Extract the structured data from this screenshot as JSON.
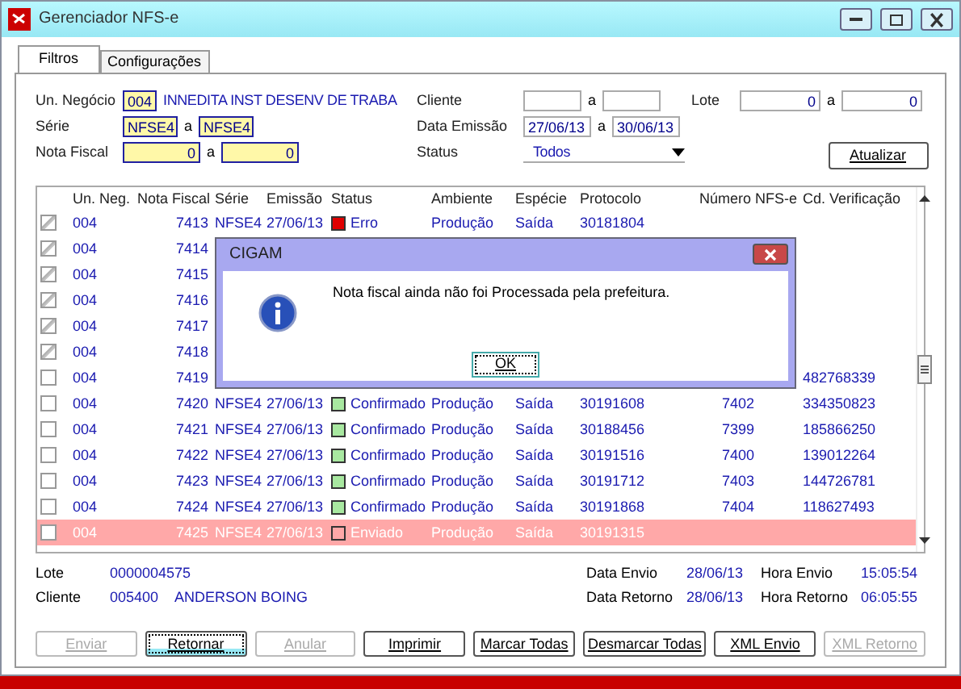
{
  "window": {
    "title": "Gerenciador NFS-e"
  },
  "tabs": [
    {
      "label": "Filtros",
      "selected": true
    },
    {
      "label": "Configurações",
      "selected": false
    }
  ],
  "filters": {
    "un_negocio": {
      "label": "Un. Negócio",
      "value": "004",
      "description": "INNEDITA INST DESENV DE TRABA",
      "required": true
    },
    "serie": {
      "label": "Série",
      "from": "NFSE4",
      "separator": "a",
      "to": "NFSE4",
      "required": true
    },
    "nota_fiscal": {
      "label": "Nota Fiscal",
      "from": "0",
      "separator": "a",
      "to": "0",
      "required": true
    },
    "cliente": {
      "label": "Cliente",
      "separator": "a",
      "required": false
    },
    "data_emissao": {
      "label": "Data Emissão",
      "from": "27/06/13",
      "separator": "a",
      "to": "30/06/13",
      "required": false
    },
    "status": {
      "label": "Status",
      "value": "Todos"
    },
    "lote": {
      "label": "Lote",
      "from": "0",
      "separator": "a",
      "to": "0",
      "required": false
    },
    "refresh_button": "Atualizar"
  },
  "table": {
    "columns": [
      "Un. Neg.",
      "Nota Fiscal",
      "Série",
      "Emissão",
      "Status",
      "Ambiente",
      "Espécie",
      "Protocolo",
      "Número NFS-e",
      "Cd. Verificação"
    ],
    "rows": [
      {
        "checked": true,
        "selected": false,
        "un_neg": "004",
        "nota_fiscal": "7413",
        "serie": "NFSE4",
        "emissao": "27/06/13",
        "status": "Erro",
        "color": "#e00000",
        "ambiente": "Produção",
        "especie": "Saída",
        "protocolo": "30181804"
      },
      {
        "checked": true,
        "selected": false,
        "un_neg": "004",
        "nota_fiscal": "7414"
      },
      {
        "checked": true,
        "selected": false,
        "un_neg": "004",
        "nota_fiscal": "7415"
      },
      {
        "checked": true,
        "selected": false,
        "un_neg": "004",
        "nota_fiscal": "7416"
      },
      {
        "checked": true,
        "selected": false,
        "un_neg": "004",
        "nota_fiscal": "7417"
      },
      {
        "checked": true,
        "selected": false,
        "un_neg": "004",
        "nota_fiscal": "7418"
      },
      {
        "checked": false,
        "selected": false,
        "un_neg": "004",
        "nota_fiscal": "7419",
        "cd_verificacao": "482768339"
      },
      {
        "checked": false,
        "selected": false,
        "un_neg": "004",
        "nota_fiscal": "7420",
        "serie": "NFSE4",
        "emissao": "27/06/13",
        "status": "Confirmado",
        "color": "#a8e8a0",
        "ambiente": "Produção",
        "especie": "Saída",
        "protocolo": "30191608",
        "numero_nfse": "7402",
        "cd_verificacao": "334350823"
      },
      {
        "checked": false,
        "selected": false,
        "un_neg": "004",
        "nota_fiscal": "7421",
        "serie": "NFSE4",
        "emissao": "27/06/13",
        "status": "Confirmado",
        "color": "#a8e8a0",
        "ambiente": "Produção",
        "especie": "Saída",
        "protocolo": "30188456",
        "numero_nfse": "7399",
        "cd_verificacao": "185866250"
      },
      {
        "checked": false,
        "selected": false,
        "un_neg": "004",
        "nota_fiscal": "7422",
        "serie": "NFSE4",
        "emissao": "27/06/13",
        "status": "Confirmado",
        "color": "#a8e8a0",
        "ambiente": "Produção",
        "especie": "Saída",
        "protocolo": "30191516",
        "numero_nfse": "7400",
        "cd_verificacao": "139012264"
      },
      {
        "checked": false,
        "selected": false,
        "un_neg": "004",
        "nota_fiscal": "7423",
        "serie": "NFSE4",
        "emissao": "27/06/13",
        "status": "Confirmado",
        "color": "#a8e8a0",
        "ambiente": "Produção",
        "especie": "Saída",
        "protocolo": "30191712",
        "numero_nfse": "7403",
        "cd_verificacao": "144726781"
      },
      {
        "checked": false,
        "selected": false,
        "un_neg": "004",
        "nota_fiscal": "7424",
        "serie": "NFSE4",
        "emissao": "27/06/13",
        "status": "Confirmado",
        "color": "#a8e8a0",
        "ambiente": "Produção",
        "especie": "Saída",
        "protocolo": "30191868",
        "numero_nfse": "7404",
        "cd_verificacao": "118627493"
      },
      {
        "checked": false,
        "selected": true,
        "un_neg": "004",
        "nota_fiscal": "7425",
        "serie": "NFSE4",
        "emissao": "27/06/13",
        "status": "Enviado",
        "color": "#ffa8a8",
        "ambiente": "Produção",
        "especie": "Saída",
        "protocolo": "30191315"
      }
    ]
  },
  "details": {
    "lote_label": "Lote",
    "lote": "0000004575",
    "cliente_label": "Cliente",
    "cliente_code": "005400",
    "cliente_name": "ANDERSON BOING",
    "data_envio_label": "Data Envio",
    "data_envio": "28/06/13",
    "hora_envio_label": "Hora Envio",
    "hora_envio": "15:05:54",
    "data_retorno_label": "Data Retorno",
    "data_retorno": "28/06/13",
    "hora_retorno_label": "Hora Retorno",
    "hora_retorno": "06:05:55"
  },
  "buttons": [
    {
      "label": "Enviar",
      "disabled": true,
      "focused": false
    },
    {
      "label": "Retornar",
      "disabled": false,
      "focused": true
    },
    {
      "label": "Anular",
      "disabled": true,
      "focused": false
    },
    {
      "label": "Imprimir",
      "disabled": false,
      "focused": false
    },
    {
      "label": "Marcar Todas",
      "disabled": false,
      "focused": false
    },
    {
      "label": "Desmarcar Todas",
      "disabled": false,
      "focused": false
    },
    {
      "label": "XML Envio",
      "disabled": false,
      "focused": false
    },
    {
      "label": "XML Retorno",
      "disabled": true,
      "focused": false
    }
  ],
  "dialog": {
    "title": "CIGAM",
    "message": "Nota fiscal ainda não foi Processada pela prefeitura.",
    "button": "OK"
  }
}
